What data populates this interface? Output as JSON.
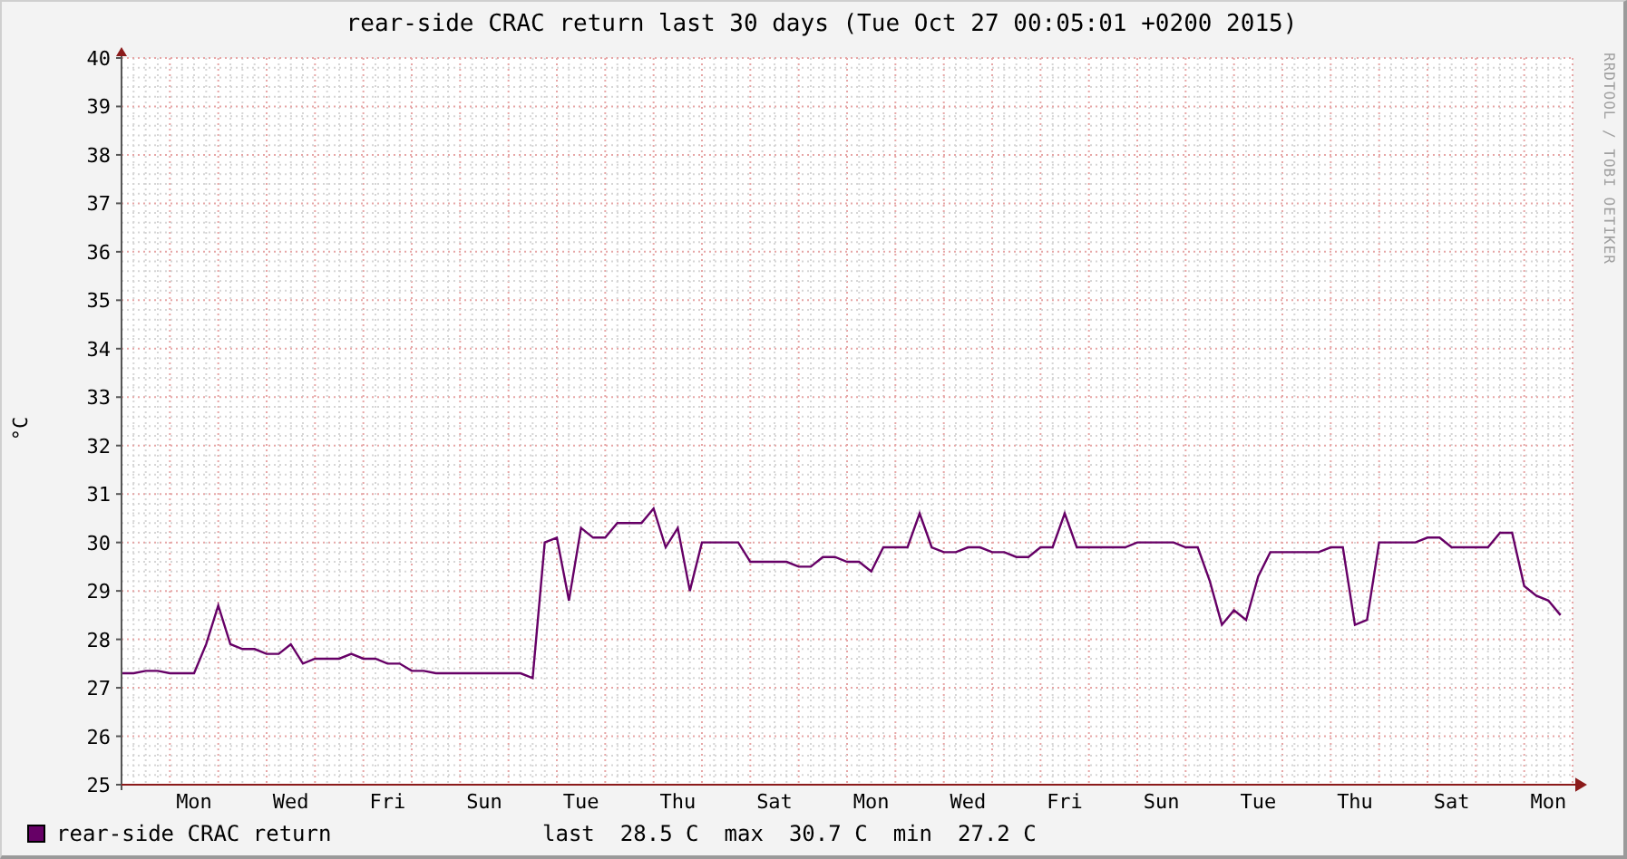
{
  "title": "rear-side CRAC return last 30 days (Tue Oct 27 00:05:01 +0200 2015)",
  "credit": "RRDTOOL / TOBI OETIKER",
  "chart_data": {
    "type": "line",
    "grid": true,
    "ylabel": "°C",
    "ylim": [
      25,
      40
    ],
    "yticks": [
      25,
      26,
      27,
      28,
      29,
      30,
      31,
      32,
      33,
      34,
      35,
      36,
      37,
      38,
      39,
      40
    ],
    "categories": [
      null,
      null,
      null,
      null,
      null,
      null,
      "Mon",
      null,
      null,
      null,
      null,
      null,
      null,
      null,
      "Wed",
      null,
      null,
      null,
      null,
      null,
      null,
      null,
      "Fri",
      null,
      null,
      null,
      null,
      null,
      null,
      null,
      "Sun",
      null,
      null,
      null,
      null,
      null,
      null,
      null,
      "Tue",
      null,
      null,
      null,
      null,
      null,
      null,
      null,
      "Thu",
      null,
      null,
      null,
      null,
      null,
      null,
      null,
      "Sat",
      null,
      null,
      null,
      null,
      null,
      null,
      null,
      "Mon",
      null,
      null,
      null,
      null,
      null,
      null,
      null,
      "Wed",
      null,
      null,
      null,
      null,
      null,
      null,
      null,
      "Fri",
      null,
      null,
      null,
      null,
      null,
      null,
      null,
      "Sun",
      null,
      null,
      null,
      null,
      null,
      null,
      null,
      "Tue",
      null,
      null,
      null,
      null,
      null,
      null,
      null,
      "Thu",
      null,
      null,
      null,
      null,
      null,
      null,
      null,
      "Sat",
      null,
      null,
      null,
      null,
      null,
      null,
      null,
      "Mon",
      null
    ],
    "series": [
      {
        "name": "rear-side CRAC return",
        "color": "#660066",
        "values": [
          27.3,
          27.3,
          27.35,
          27.35,
          27.3,
          27.3,
          27.3,
          27.9,
          28.7,
          27.9,
          27.8,
          27.8,
          27.7,
          27.7,
          27.9,
          27.5,
          27.6,
          27.6,
          27.6,
          27.7,
          27.6,
          27.6,
          27.5,
          27.5,
          27.35,
          27.35,
          27.3,
          27.3,
          27.3,
          27.3,
          27.3,
          27.3,
          27.3,
          27.3,
          27.2,
          30.0,
          30.1,
          28.8,
          30.3,
          30.1,
          30.1,
          30.4,
          30.4,
          30.4,
          30.7,
          29.9,
          30.3,
          29.0,
          30.0,
          30.0,
          30.0,
          30.0,
          29.6,
          29.6,
          29.6,
          29.6,
          29.5,
          29.5,
          29.7,
          29.7,
          29.6,
          29.6,
          29.4,
          29.9,
          29.9,
          29.9,
          30.6,
          29.9,
          29.8,
          29.8,
          29.9,
          29.9,
          29.8,
          29.8,
          29.7,
          29.7,
          29.9,
          29.9,
          30.6,
          29.9,
          29.9,
          29.9,
          29.9,
          29.9,
          30.0,
          30.0,
          30.0,
          30.0,
          29.9,
          29.9,
          29.2,
          28.3,
          28.6,
          28.4,
          29.3,
          29.8,
          29.8,
          29.8,
          29.8,
          29.8,
          29.9,
          29.9,
          28.3,
          28.4,
          30.0,
          30.0,
          30.0,
          30.0,
          30.1,
          30.1,
          29.9,
          29.9,
          29.9,
          29.9,
          30.2,
          30.2,
          29.1,
          28.9,
          28.8,
          28.5
        ]
      }
    ]
  },
  "legend": {
    "stats": [
      {
        "label": "last",
        "value": "28.5 C"
      },
      {
        "label": "max",
        "value": "30.7 C"
      },
      {
        "label": "min",
        "value": "27.2 C"
      }
    ]
  }
}
